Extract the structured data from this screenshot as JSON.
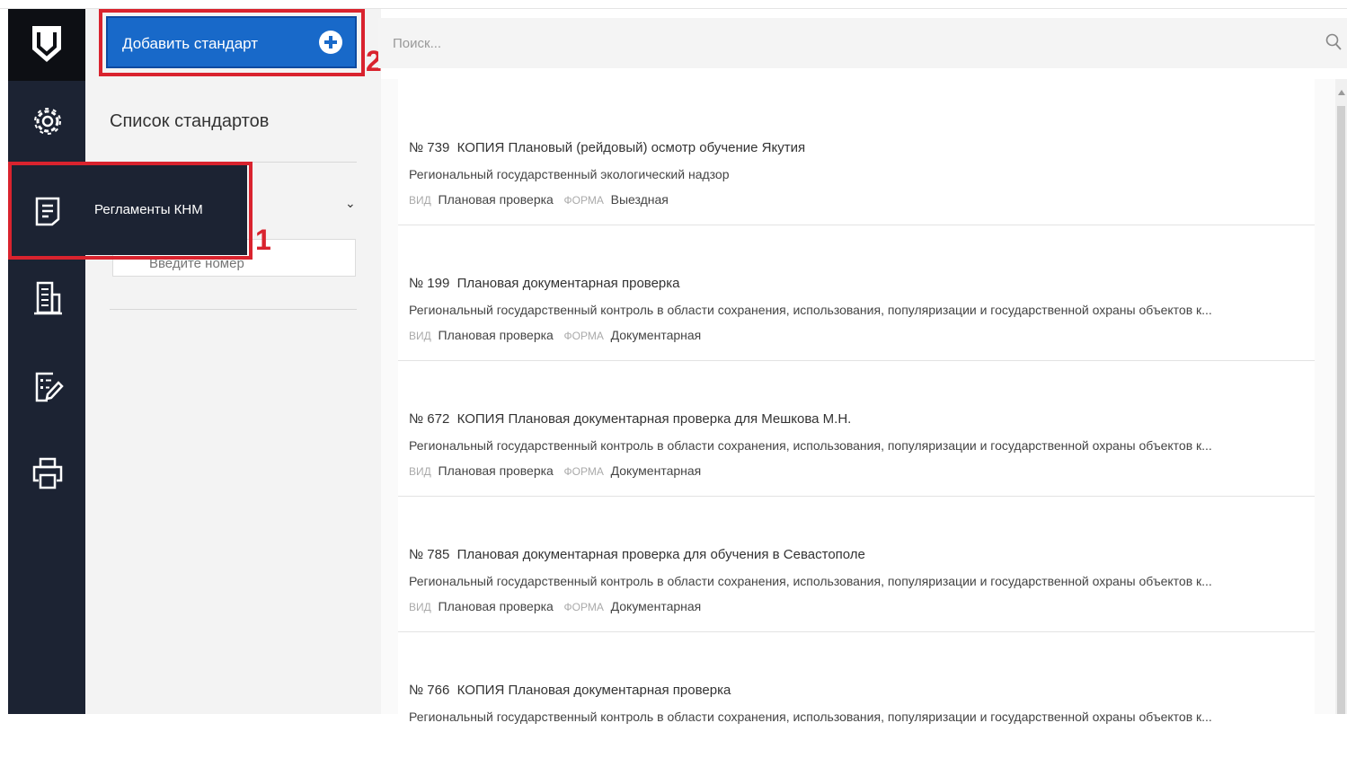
{
  "header": {
    "add_button_label": "Добавить стандарт",
    "search_placeholder": "Поиск..."
  },
  "sidebar": {
    "popup_label": "Регламенты КНМ",
    "icons": [
      "settings-icon",
      "document-icon",
      "building-icon",
      "checklist-edit-icon",
      "printer-icon"
    ]
  },
  "filter": {
    "title": "Список стандартов",
    "number_placeholder": "Введите номер"
  },
  "markers": {
    "one": "1",
    "two": "2"
  },
  "labels": {
    "vid": "ВИД",
    "forma": "ФОРМА"
  },
  "standards": [
    {
      "num": "№ 739",
      "title": "КОПИЯ Плановый (рейдовый) осмотр обучение Якутия",
      "subtitle": "Региональный государственный экологический надзор",
      "vid": "Плановая проверка",
      "forma": "Выездная"
    },
    {
      "num": "№ 199",
      "title": "Плановая документарная проверка",
      "subtitle": "Региональный государственный контроль в области сохранения, использования, популяризации и государственной охраны объектов к...",
      "vid": "Плановая проверка",
      "forma": "Документарная"
    },
    {
      "num": "№ 672",
      "title": "КОПИЯ Плановая документарная проверка для Мешкова М.Н.",
      "subtitle": "Региональный государственный контроль в области сохранения, использования, популяризации и государственной охраны объектов к...",
      "vid": "Плановая проверка",
      "forma": "Документарная"
    },
    {
      "num": "№ 785",
      "title": "Плановая документарная проверка для обучения в Севастополе",
      "subtitle": "Региональный государственный контроль в области сохранения, использования, популяризации и государственной охраны объектов к...",
      "vid": "Плановая проверка",
      "forma": "Документарная"
    },
    {
      "num": "№ 766",
      "title": "КОПИЯ Плановая документарная проверка",
      "subtitle": "Региональный государственный контроль в области сохранения, использования, популяризации и государственной охраны объектов к...",
      "vid": "",
      "forma": ""
    }
  ],
  "colors": {
    "primary": "#1869c9",
    "sidebar": "#1c2333",
    "highlight": "#d9232e"
  }
}
